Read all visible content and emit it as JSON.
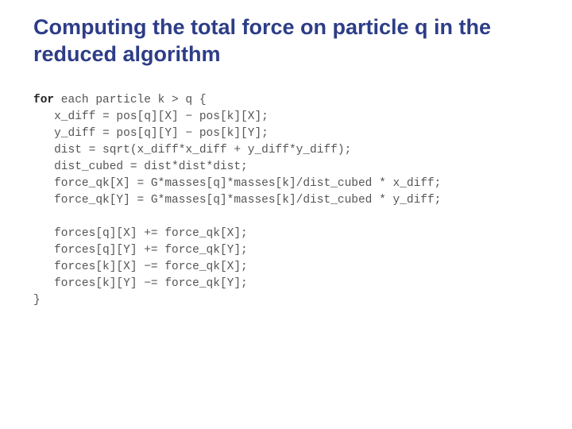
{
  "title": "Computing the total force on particle q in the reduced algorithm",
  "code": {
    "for_kw": "for",
    "l0": " each particle k > q {",
    "l1": "   x_diff = pos[q][X] − pos[k][X];",
    "l2": "   y_diff = pos[q][Y] − pos[k][Y];",
    "l3": "   dist = sqrt(x_diff*x_diff + y_diff*y_diff);",
    "l4": "   dist_cubed = dist*dist*dist;",
    "l5": "   force_qk[X] = G*masses[q]*masses[k]/dist_cubed * x_diff;",
    "l6": "   force_qk[Y] = G*masses[q]*masses[k]/dist_cubed * y_diff;",
    "l7": "",
    "l8": "   forces[q][X] += force_qk[X];",
    "l9": "   forces[q][Y] += force_qk[Y];",
    "l10": "   forces[k][X] −= force_qk[X];",
    "l11": "   forces[k][Y] −= force_qk[Y];",
    "l12": "}"
  }
}
